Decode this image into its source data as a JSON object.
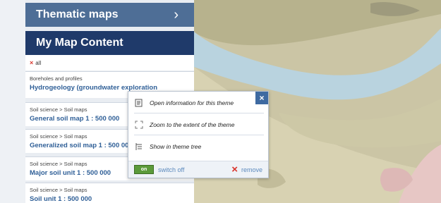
{
  "sidebar": {
    "thematic_label": "Thematic maps",
    "thematic_chevron": "›",
    "mymap_label": "My Map Content",
    "remove_all_label": "all",
    "layers": [
      {
        "crumb": "Boreholes and profiles",
        "name": "Hydrogeology (groundwater exploration"
      },
      {
        "crumb": "Soil science  >  Soil maps",
        "name": "General soil map 1 : 500 000"
      },
      {
        "crumb": "Soil science  >  Soil maps",
        "name": "Generalized soil map 1 : 500 000"
      },
      {
        "crumb": "Soil science  >  Soil maps",
        "name": "Major soil unit 1 : 500 000"
      },
      {
        "crumb": "Soil science  >  Soil maps",
        "name": "Soil unit 1 : 500 000"
      }
    ]
  },
  "popup": {
    "close_label": "×",
    "items": [
      {
        "label": "Open information for this theme",
        "icon": "info-document-icon"
      },
      {
        "label": "Zoom to the extent of the theme",
        "icon": "zoom-extent-icon"
      },
      {
        "label": "Show in theme tree",
        "icon": "tree-icon"
      }
    ],
    "toggle_label": "on",
    "switch_label": "switch off",
    "remove_label": "remove"
  },
  "colors": {
    "thematic_bg": "#4e6e96",
    "mymap_bg": "#1f3a6a",
    "link": "#2f5f97",
    "toggle_on": "#5b9a3a",
    "remove_x": "#d9342b"
  }
}
